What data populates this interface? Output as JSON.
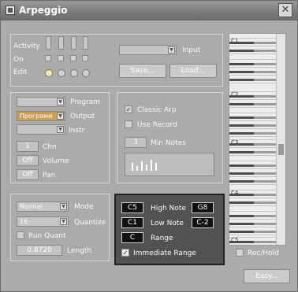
{
  "window": {
    "title": "Arpeggio"
  },
  "activity": {
    "label_activity": "Activity",
    "label_on": "On",
    "label_edit": "Edit"
  },
  "input": {
    "value": "",
    "label": "Input"
  },
  "buttons": {
    "save": "Save...",
    "load": "Load...",
    "easy": "Easy..."
  },
  "midi": {
    "program_label": "Program",
    "output_value": "Програми",
    "output_label": "Output",
    "instr_label": "Instr",
    "chn_value": "1",
    "chn_label": "Chn",
    "volume_value": "Off",
    "volume_label": "Volume",
    "pan_value": "Off",
    "pan_label": "Pan"
  },
  "arp_options": {
    "classic_label": "Classic Arp",
    "classic_checked": true,
    "use_record_label": "Use Record",
    "use_record_checked": false,
    "min_notes_value": "3",
    "min_notes_label": "Min Notes"
  },
  "mode": {
    "mode_value": "Normal",
    "mode_label": "Mode",
    "quantize_value": "16",
    "quantize_label": "Quantize",
    "run_quant_label": "Run Quant",
    "length_value": "0.8720",
    "length_label": "Length"
  },
  "range": {
    "high_value_left": "C5",
    "high_label": "High Note",
    "high_value_right": "G8",
    "low_value_left": "C1",
    "low_label": "Low Note",
    "low_value_right": "C-2",
    "range_value": "C",
    "range_label": "Range",
    "immediate_label": "Immediate Range",
    "immediate_checked": true
  },
  "keyboard": {
    "octaves": [
      "C1",
      "C2",
      "C3",
      "C4",
      "C5"
    ]
  },
  "rec_hold": {
    "label": "Rec/Hold",
    "checked": false
  }
}
